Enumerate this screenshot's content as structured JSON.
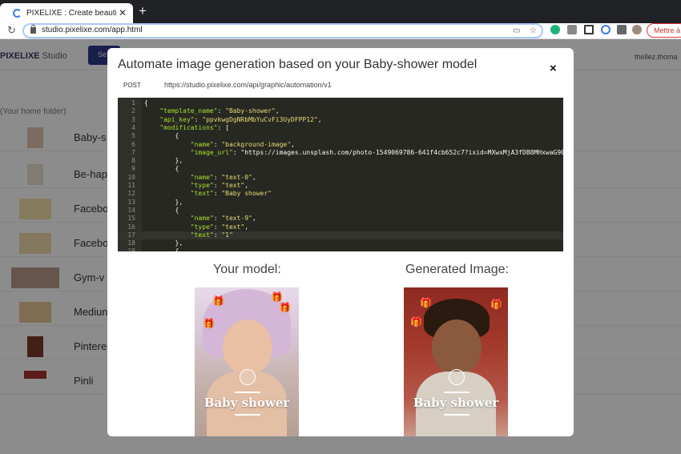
{
  "browser": {
    "tab_title": "PIXELIXE : Create beautiful and",
    "url": "studio.pixelixe.com/app.html",
    "update_button": "Mettre à"
  },
  "app": {
    "logo": "PIXELIXE",
    "logo_suffix": "Studio",
    "header_button": "Se",
    "user": "thellez.thoma",
    "folder": "(Your home folder)",
    "items": [
      {
        "label": "Baby-s"
      },
      {
        "label": "Be-hap"
      },
      {
        "label": "Facebo"
      },
      {
        "label": "Facebo"
      },
      {
        "label": "Gym-v"
      },
      {
        "label": "Mediun"
      },
      {
        "label": "Pintere"
      },
      {
        "label": "Pinli"
      }
    ]
  },
  "modal": {
    "title": "Automate image generation based on your Baby-shower model",
    "close": "×",
    "method": "POST",
    "endpoint": "https://studio.pixelixe.com/api/graphic/automation/v1",
    "code_lines": [
      {
        "n": "1",
        "text": "{"
      },
      {
        "n": "2",
        "text": "    \"template_name\": \"Baby-shower\","
      },
      {
        "n": "3",
        "text": "    \"api_key\": \"ppvkwgDgNRbMbYuCvFi3UyDFPP12\","
      },
      {
        "n": "4",
        "text": "    \"modifications\": ["
      },
      {
        "n": "5",
        "text": "        {"
      },
      {
        "n": "6",
        "text": "            \"name\": \"background-image\","
      },
      {
        "n": "7",
        "text": "            \"image_url\": \"https://images.unsplash.com/photo-1549069786-641f4cb652c7?ixid=MXwxMjA3fDB8MHxwaG90by1"
      },
      {
        "n": "8",
        "text": "        },"
      },
      {
        "n": "9",
        "text": "        {"
      },
      {
        "n": "10",
        "text": "            \"name\": \"text-0\","
      },
      {
        "n": "11",
        "text": "            \"type\": \"text\","
      },
      {
        "n": "12",
        "text": "            \"text\": \"Baby shower\""
      },
      {
        "n": "13",
        "text": "        },"
      },
      {
        "n": "14",
        "text": "        {"
      },
      {
        "n": "15",
        "text": "            \"name\": \"text-9\","
      },
      {
        "n": "16",
        "text": "            \"type\": \"text\","
      },
      {
        "n": "17",
        "text": "            \"text\": \"1\""
      },
      {
        "n": "18",
        "text": "        },"
      },
      {
        "n": "19",
        "text": "        {"
      }
    ],
    "model_heading": "Your model:",
    "generated_heading": "Generated Image:",
    "model_poster_text": "Baby shower",
    "generated_poster_text": "Baby shower"
  },
  "colors": {
    "accent": "#2c3a8c",
    "code_bg": "#272822",
    "code_key": "#a6e22e",
    "code_string": "#e6db74"
  }
}
